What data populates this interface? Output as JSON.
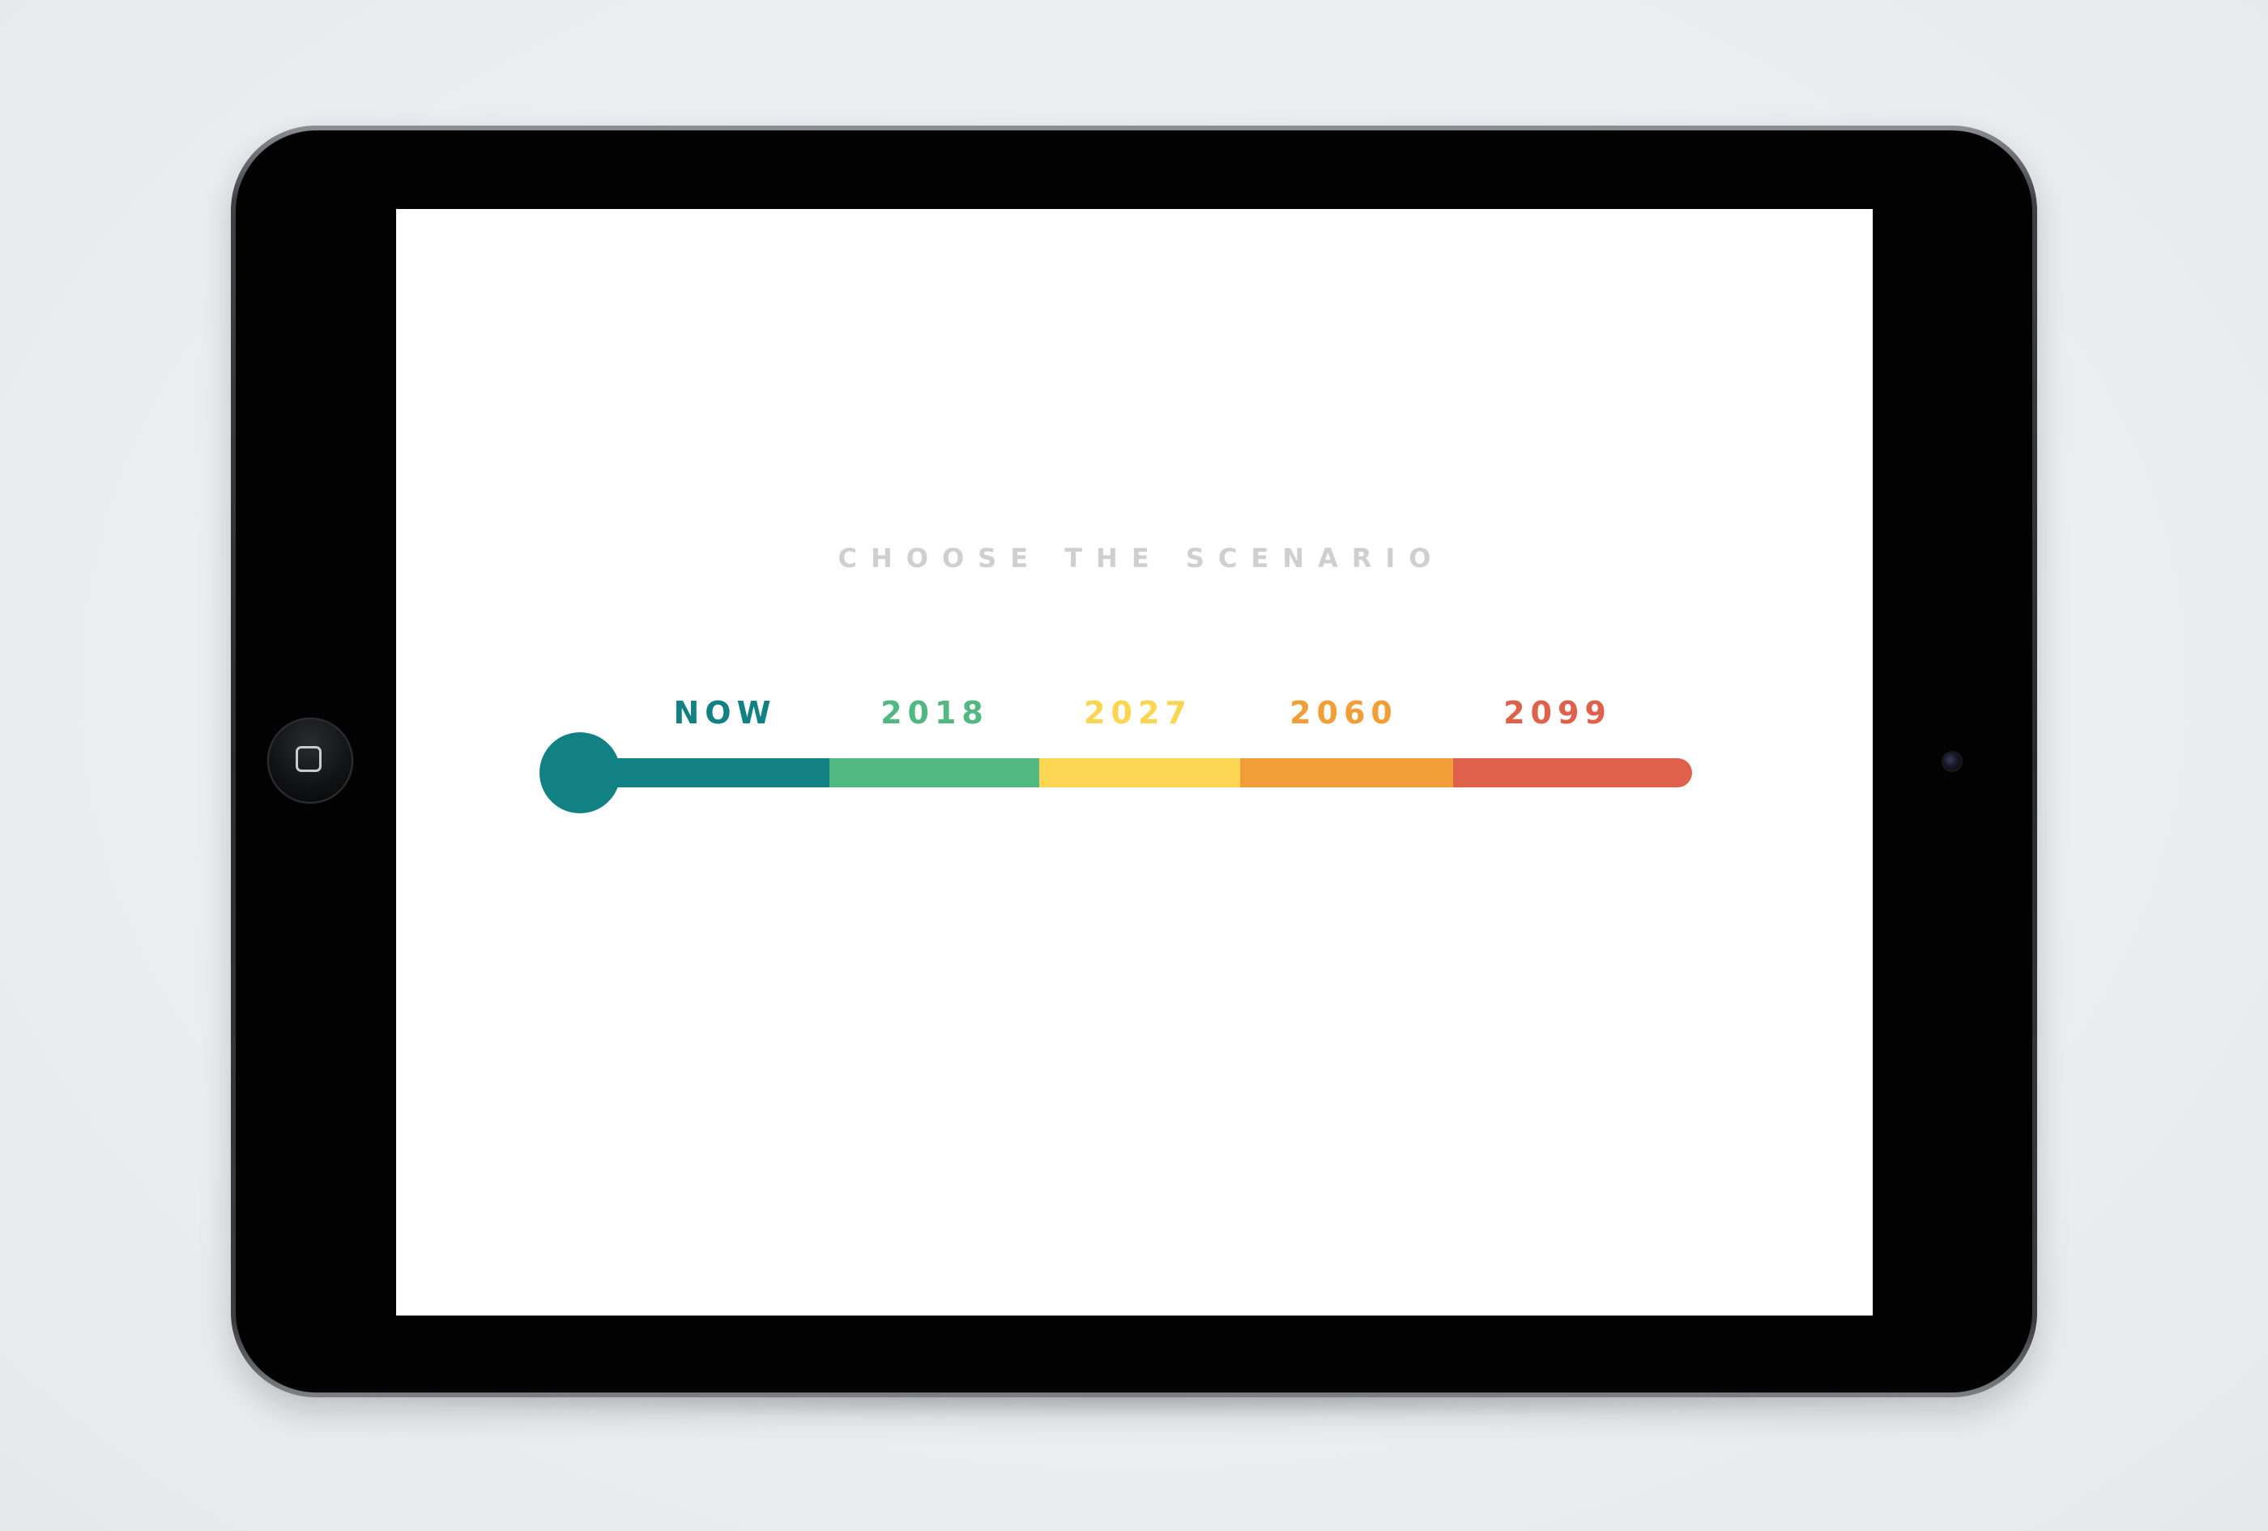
{
  "screen": {
    "title": "CHOOSE THE SCENARIO"
  },
  "scenarios": [
    {
      "label": "NOW",
      "color": "#118183"
    },
    {
      "label": "2018",
      "color": "#52b882"
    },
    {
      "label": "2027",
      "color": "#fcd653"
    },
    {
      "label": "2060",
      "color": "#f29e38"
    },
    {
      "label": "2099",
      "color": "#e0614b"
    }
  ],
  "slider": {
    "selected": "NOW",
    "knob_color": "#118183"
  },
  "device": {
    "home_button_icon": "home-button-square-icon",
    "camera_icon": "front-camera-icon"
  }
}
